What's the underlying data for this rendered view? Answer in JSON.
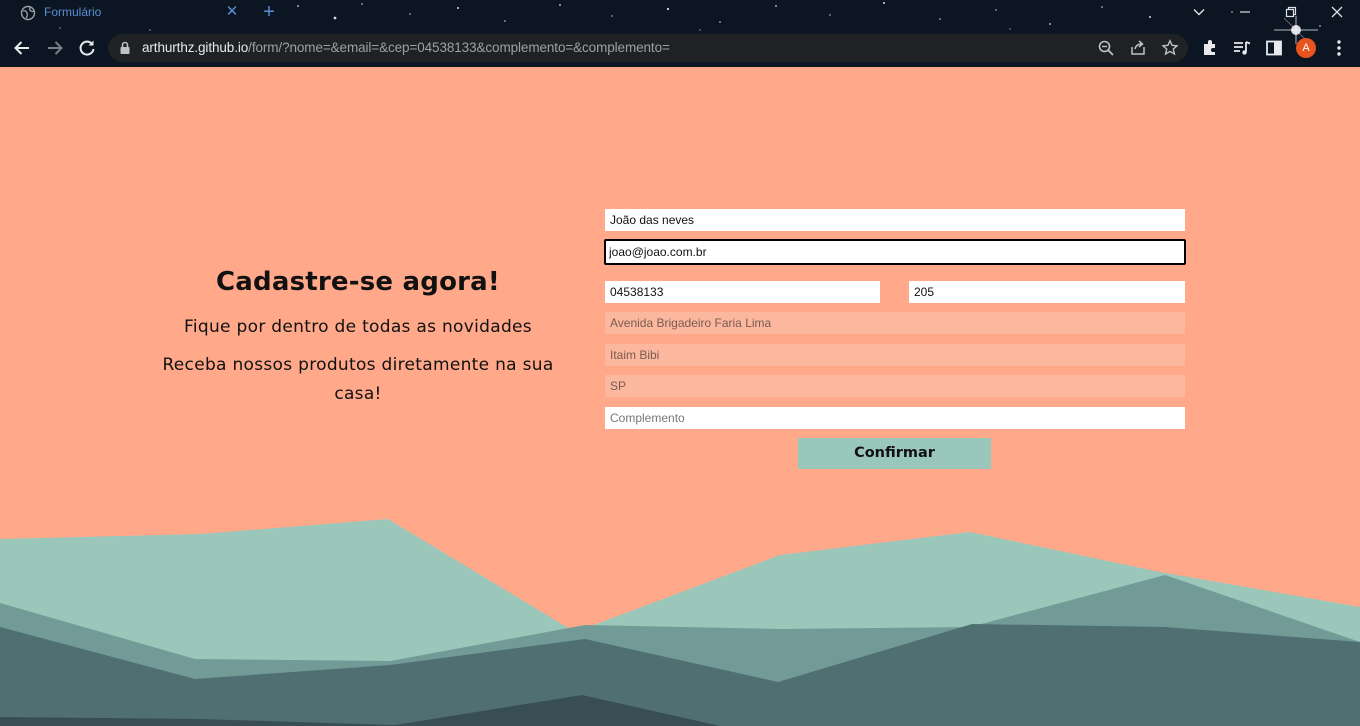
{
  "browser": {
    "tab": {
      "title": "Formulário",
      "close_icon": "close-icon"
    },
    "new_tab_symbol": "+",
    "url_host": "arthurthz.github.io",
    "url_path": "/form/?nome=&email=&cep=04538133&complemento=&complemento=",
    "profile_initial": "A",
    "colors": {
      "frame": "#0c1522",
      "omnibox": "#202124",
      "accent": "#5b8fd6",
      "avatar": "#e8541f"
    }
  },
  "page": {
    "background": "#ffa88a",
    "heading": "Cadastre-se agora!",
    "subtitle1": "Fique por dentro de todas as novidades",
    "subtitle2": "Receba nossos produtos diretamente na sua casa!"
  },
  "form": {
    "nome": {
      "value": "João das neves"
    },
    "email": {
      "value": "joao@joao.com.br"
    },
    "cep": {
      "value": "04538133"
    },
    "numero": {
      "value": "205"
    },
    "rua": {
      "value": "Avenida Brigadeiro Faria Lima"
    },
    "bairro": {
      "value": "Itaim Bibi"
    },
    "estado": {
      "value": "SP"
    },
    "complemento": {
      "value": "",
      "placeholder": "Complemento"
    },
    "submit_label": "Confirmar",
    "colors": {
      "readonly_field": "#fbb89f",
      "button": "#99c7bb"
    }
  },
  "mountain_colors": [
    "#9bc7bb",
    "#729b98",
    "#4f6f73",
    "#384e54"
  ]
}
